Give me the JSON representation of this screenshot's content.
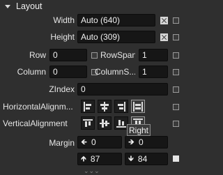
{
  "section": {
    "title": "Layout"
  },
  "width": {
    "label": "Width",
    "value": "Auto (640)"
  },
  "height": {
    "label": "Height",
    "value": "Auto (309)"
  },
  "row": {
    "label": "Row",
    "value": "0"
  },
  "rowspan": {
    "label": "RowSpan",
    "value": "1"
  },
  "column": {
    "label": "Column",
    "value": "0"
  },
  "columnspan": {
    "label": "ColumnS...",
    "value": "1"
  },
  "zindex": {
    "label": "ZIndex",
    "value": "0"
  },
  "horizontal_alignment": {
    "label": "HorizontalAlignm...",
    "options": [
      "Left",
      "Center",
      "Right",
      "Stretch"
    ],
    "selected": "Stretch"
  },
  "vertical_alignment": {
    "label": "VerticalAlignment",
    "options": [
      "Top",
      "Center",
      "Bottom",
      "Stretch"
    ],
    "selected": "Stretch"
  },
  "tooltip": {
    "text": "Right"
  },
  "margin": {
    "label": "Margin",
    "left": "0",
    "right": "0",
    "top": "87",
    "bottom": "84"
  }
}
